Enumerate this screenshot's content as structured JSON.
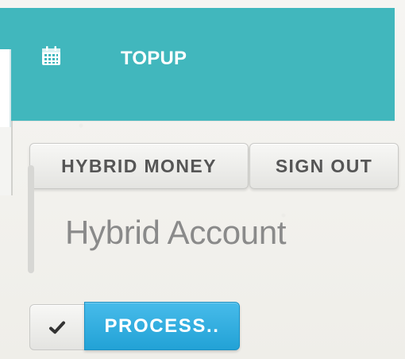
{
  "header": {
    "title": "TOPUP",
    "icon": "calendar-icon",
    "background_color": "#41b7bd"
  },
  "tabs": [
    {
      "label": "HYBRID MONEY"
    },
    {
      "label": "SIGN OUT"
    }
  ],
  "account": {
    "label": "Hybrid Account"
  },
  "actions": {
    "check_icon": "check-icon",
    "process_label": "PROCESS..",
    "process_color": "#2aa8dc"
  }
}
